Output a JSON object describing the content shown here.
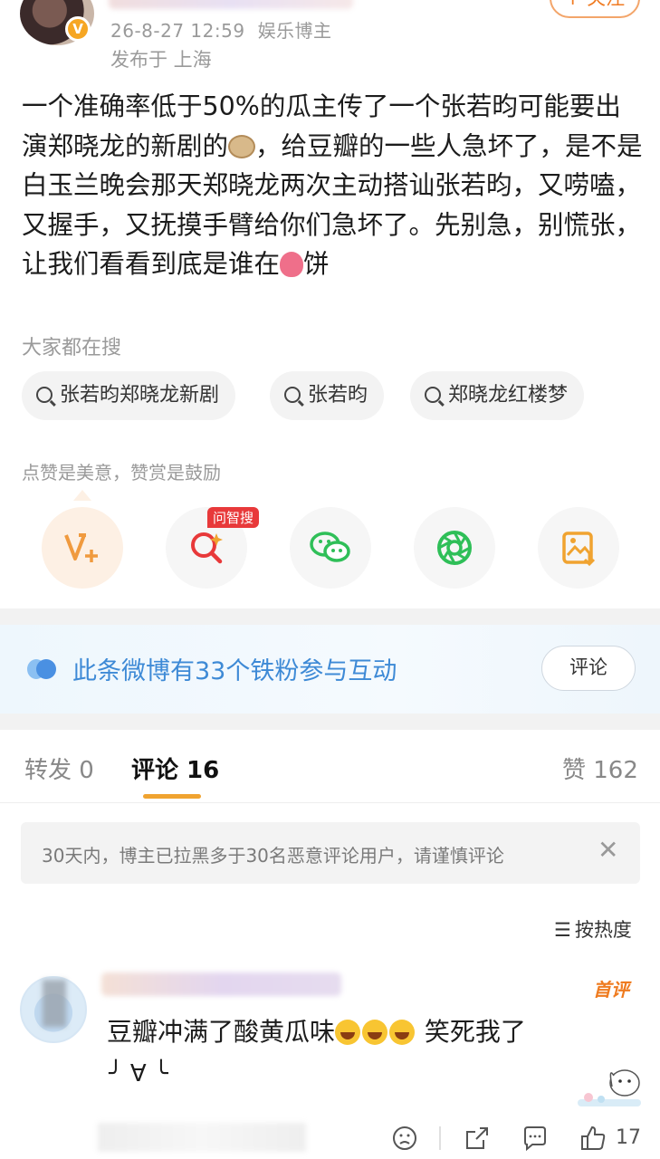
{
  "header": {
    "date": "26-8-27 12:59",
    "author_tag": "娱乐博主",
    "location": "发布于 上海",
    "follow_label": "+ 关注"
  },
  "post": {
    "text_before_emoji1": "一个准确率低于50%的瓜主传了一个张若昀可能要出演郑晓龙的新剧的",
    "text_after_emoji1": "，给豆瓣的一些人急坏了，是不是白玉兰晚会那天郑晓龙两次主动搭讪张若昀，又唠嗑，又握手，又抚摸手臂给你们急坏了。先别急，别慌张，让我们看看到底是谁在",
    "text_after_emoji2": "饼"
  },
  "search": {
    "title": "大家都在搜",
    "chips": [
      "张若昀郑晓龙新剧",
      "张若昀",
      "郑晓龙红楼梦"
    ]
  },
  "actions": {
    "hint": "点赞是美意，赞赏是鼓励",
    "ai_badge": "问智搜",
    "icons": [
      "v-plus-icon",
      "ai-search-icon",
      "wechat-icon",
      "moments-icon",
      "save-image-icon"
    ]
  },
  "fans": {
    "text": "此条微博有33个铁粉参与互动",
    "button": "评论"
  },
  "tabs": {
    "repost": "转发 0",
    "comments": "评论 16",
    "likes": "赞 162"
  },
  "notice": {
    "text": "30天内，博主已拉黑多于30名恶意评论用户，请谨慎评论"
  },
  "sort": {
    "label": "按热度"
  },
  "comment": {
    "badge": "首评",
    "text_before_emoji": "豆瓣冲满了酸黄瓜味",
    "text_after_emoji": " 笑死我了",
    "kaomoji": "╯ ∀ ╰",
    "like_count": "17"
  },
  "colors": {
    "accent": "#f07b22",
    "link_blue": "#3e8ad6",
    "badge_red": "#e8393a"
  }
}
